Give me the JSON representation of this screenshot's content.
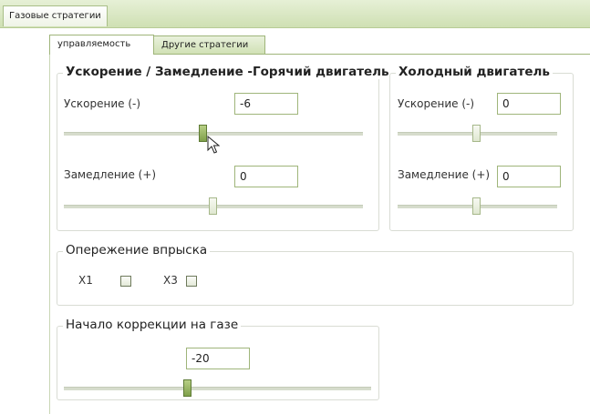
{
  "window": {
    "tab_label": "Газовые стратегии"
  },
  "tabs": [
    {
      "label": "управляемость",
      "active": true
    },
    {
      "label": "Другие стратегии",
      "active": false
    }
  ],
  "hot_engine": {
    "title": "Ускорение / Замедление -Горячий двигатель",
    "accel_label": "Ускорение (-)",
    "accel_value": "-6",
    "accel_slider_level": 0.43,
    "decel_label": "Замедление (+)",
    "decel_value": "0",
    "decel_slider_level": 0.5
  },
  "cold_engine": {
    "title": "Холодный двигатель",
    "accel_label": "Ускорение (-)",
    "accel_value": "0",
    "accel_slider_level": 0.5,
    "decel_label": "Замедление (+)",
    "decel_value": "0",
    "decel_slider_level": 0.5
  },
  "injection_advance": {
    "title": "Опережение впрыска",
    "x1_label": "X1",
    "x1_checked": false,
    "x3_label": "X3",
    "x3_checked": false
  },
  "gas_correction": {
    "title": "Начало коррекции на газе",
    "value": "-20",
    "slider_level": 0.4
  },
  "colors": {
    "accent": "#9fb57a",
    "topbar": "#cfe0b3",
    "thumb_active": "#7fa04a"
  }
}
